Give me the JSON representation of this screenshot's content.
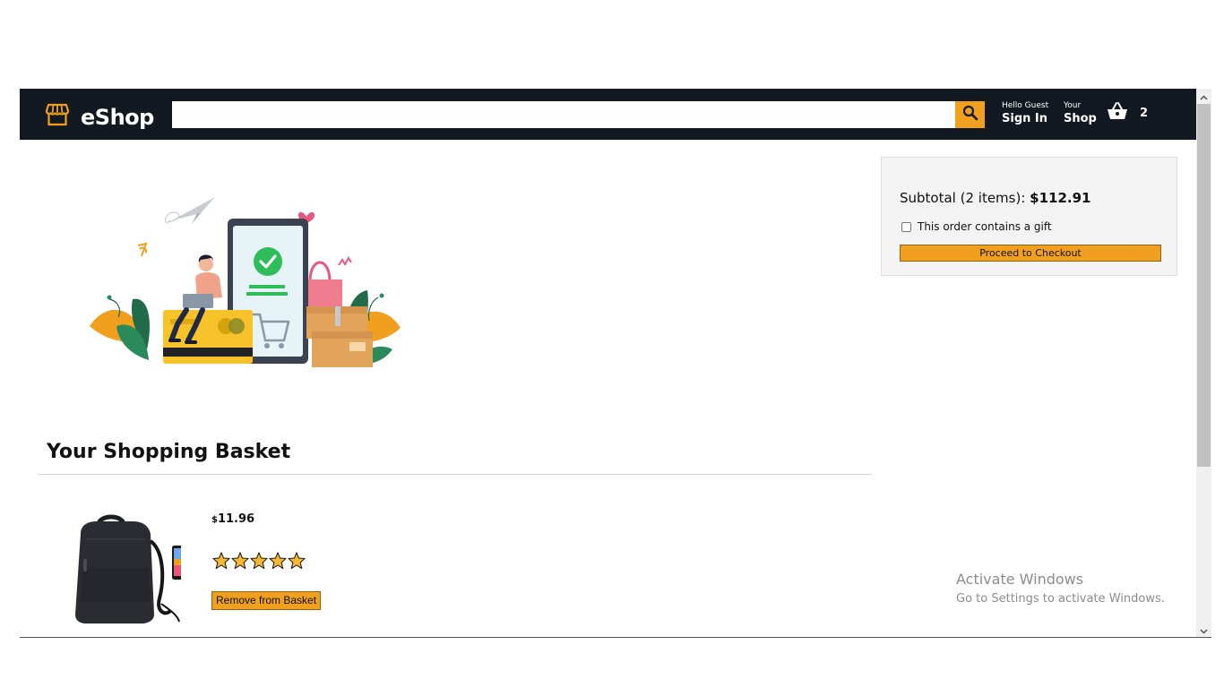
{
  "app": {
    "name": "eShop"
  },
  "header": {
    "search": {
      "value": "",
      "placeholder": ""
    },
    "sign_in": {
      "line1": "Hello Guest",
      "line2": "Sign In"
    },
    "your_shop": {
      "line1": "Your",
      "line2": "Shop"
    },
    "basket_count": "2"
  },
  "basket": {
    "title": "Your Shopping Basket",
    "items": [
      {
        "currency": "$",
        "price": "11.96",
        "rating": 5,
        "rating_stars": "★★★★★",
        "remove_label": "Remove from Basket"
      }
    ]
  },
  "subtotal": {
    "label": "Subtotal (2 items):",
    "amount": "$112.91",
    "gift_label": "This order contains a gift",
    "gift_checked": false,
    "checkout_label": "Proceed to Checkout"
  },
  "watermark": {
    "line1": "Activate Windows",
    "line2": "Go to Settings to activate Windows."
  },
  "colors": {
    "header_bg": "#131921",
    "accent": "#f0a01e",
    "subtotal_bg": "#f3f3f3"
  },
  "icons": [
    "storefront-icon",
    "search-icon",
    "shopping-basket-icon",
    "star-icon",
    "chevron-up-icon",
    "chevron-down-icon"
  ]
}
